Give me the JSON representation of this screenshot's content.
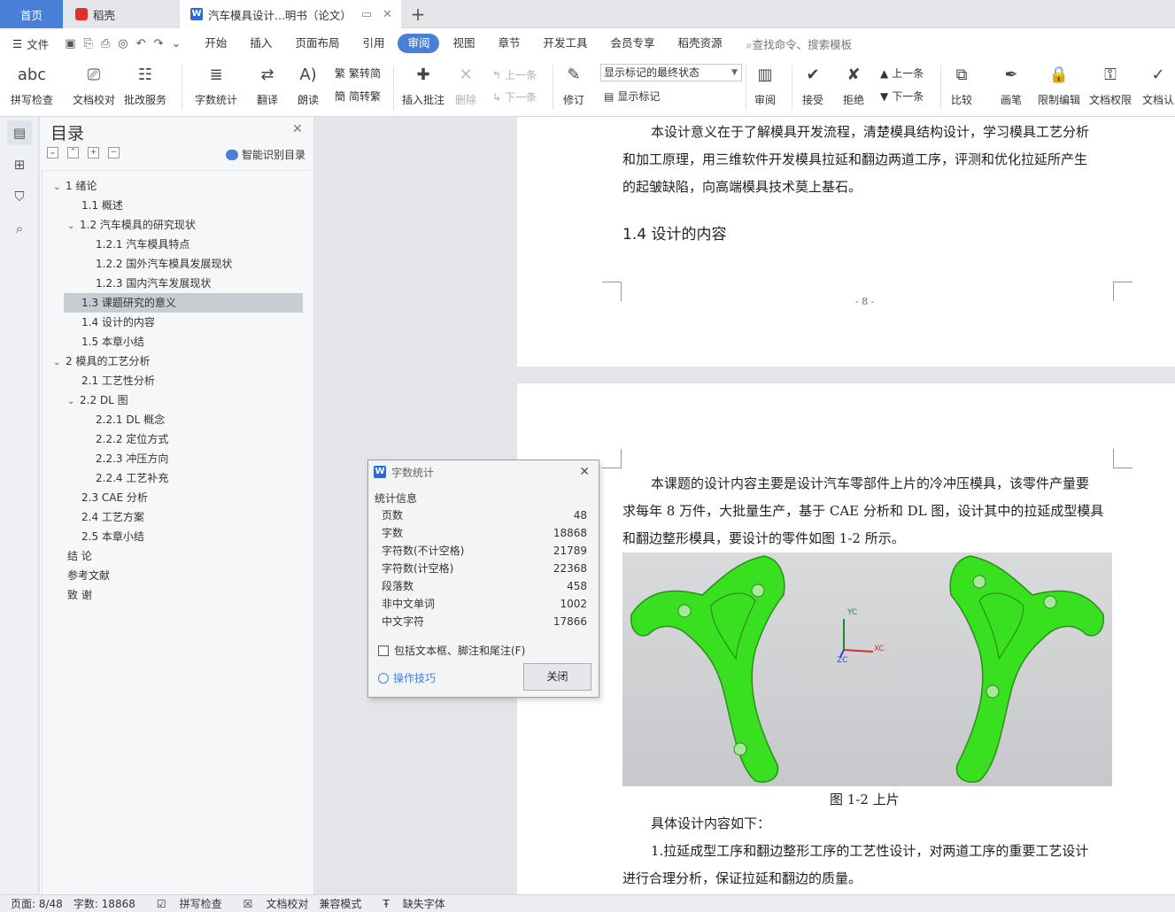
{
  "tabs": {
    "home": "首页",
    "daoke": "稻壳",
    "doc": "汽车模具设计...明书（论文）",
    "add": "+"
  },
  "menubar": {
    "file": "文件",
    "items": [
      "开始",
      "插入",
      "页面布局",
      "引用",
      "审阅",
      "视图",
      "章节",
      "开发工具",
      "会员专享",
      "稻壳资源"
    ],
    "search": "查找命令、搜索模板"
  },
  "ribbon": {
    "spellcheck": "拼写检查",
    "doccheck": "文档校对",
    "batch": "批改服务",
    "wordcount": "字数统计",
    "translate": "翻译",
    "read": "朗读",
    "fan": "繁转简",
    "jian": "简转繁",
    "insertcomment": "插入批注",
    "delete": "删除",
    "prev_comment": "上一条",
    "next_comment": "下一条",
    "revise": "修订",
    "markup_state": "显示标记的最终状态",
    "show_markup": "显示标记",
    "review": "审阅",
    "accept": "接受",
    "reject": "拒绝",
    "prev": "上一条",
    "next": "下一条",
    "compare": "比较",
    "pen": "画笔",
    "restrict": "限制编辑",
    "perm": "文档权限",
    "auth": "文档认"
  },
  "toc": {
    "title": "目录",
    "ai": "智能识别目录",
    "items": [
      {
        "label": "1  绪论"
      },
      {
        "label": "1.1  概述"
      },
      {
        "label": "1.2  汽车模具的研究现状"
      },
      {
        "label": "1.2.1  汽车模具特点"
      },
      {
        "label": "1.2.2  国外汽车模具发展现状"
      },
      {
        "label": "1.2.3  国内汽车发展现状"
      },
      {
        "label": "1.3  课题研究的意义"
      },
      {
        "label": "1.4  设计的内容"
      },
      {
        "label": "1.5  本章小结"
      },
      {
        "label": "2  模具的工艺分析"
      },
      {
        "label": "2.1  工艺性分析"
      },
      {
        "label": "2.2 DL 图"
      },
      {
        "label": "2.2.1 DL 概念"
      },
      {
        "label": "2.2.2  定位方式"
      },
      {
        "label": "2.2.3  冲压方向"
      },
      {
        "label": "2.2.4  工艺补充"
      },
      {
        "label": "2.3 CAE 分析"
      },
      {
        "label": "2.4  工艺方案"
      },
      {
        "label": "2.5  本章小结"
      },
      {
        "label": "结   论"
      },
      {
        "label": "参考文献"
      },
      {
        "label": "致   谢"
      }
    ]
  },
  "doc": {
    "p1_l1": "本设计意义在于了解模具开发流程，清楚模具结构设计，学习模具工艺分析",
    "p1_l2": "和加工原理，用三维软件开发模具拉延和翻边两道工序，评测和优化拉延所产生",
    "p1_l3": "的起皱缺陷，向高端模具技术莫上基石。",
    "heading": "1.4  设计的内容",
    "page_num": "- 8 -",
    "p2_l1": "本课题的设计内容主要是设计汽车零部件上片的冷冲压模具，该零件产量要",
    "p2_l2": "求每年 8 万件，大批量生产，基于 CAE 分析和 DL 图，设计其中的拉延成型模具",
    "p2_l3": "和翻边整形模具，要设计的零件如图 1-2 所示。",
    "fig_yc": "YC",
    "fig_xc": "XC",
    "fig_zc": "ZC",
    "caption": "图 1-2  上片",
    "p3": "具体设计内容如下：",
    "p4_l1": "1.拉延成型工序和翻边整形工序的工艺性设计，对两道工序的重要工艺设计",
    "p4_l2": "进行合理分析，保证拉延和翻边的质量。"
  },
  "dialog": {
    "title": "字数统计",
    "section": "统计信息",
    "rows": [
      {
        "label": "页数",
        "value": "48"
      },
      {
        "label": "字数",
        "value": "18868"
      },
      {
        "label": "字符数(不计空格)",
        "value": "21789"
      },
      {
        "label": "字符数(计空格)",
        "value": "22368"
      },
      {
        "label": "段落数",
        "value": "458"
      },
      {
        "label": "非中文单词",
        "value": "1002"
      },
      {
        "label": "中文字符",
        "value": "17866"
      }
    ],
    "checkbox": "包括文本框、脚注和尾注(F)",
    "tips": "操作技巧",
    "close": "关闭"
  },
  "status": {
    "page": "页面: 8/48",
    "words": "字数: 18868",
    "spell": "拼写检查",
    "check": "文档校对",
    "compat": "兼容模式",
    "font": "缺失字体"
  },
  "colors": {
    "accent": "#4a7fd8",
    "part": "#39e01f"
  }
}
